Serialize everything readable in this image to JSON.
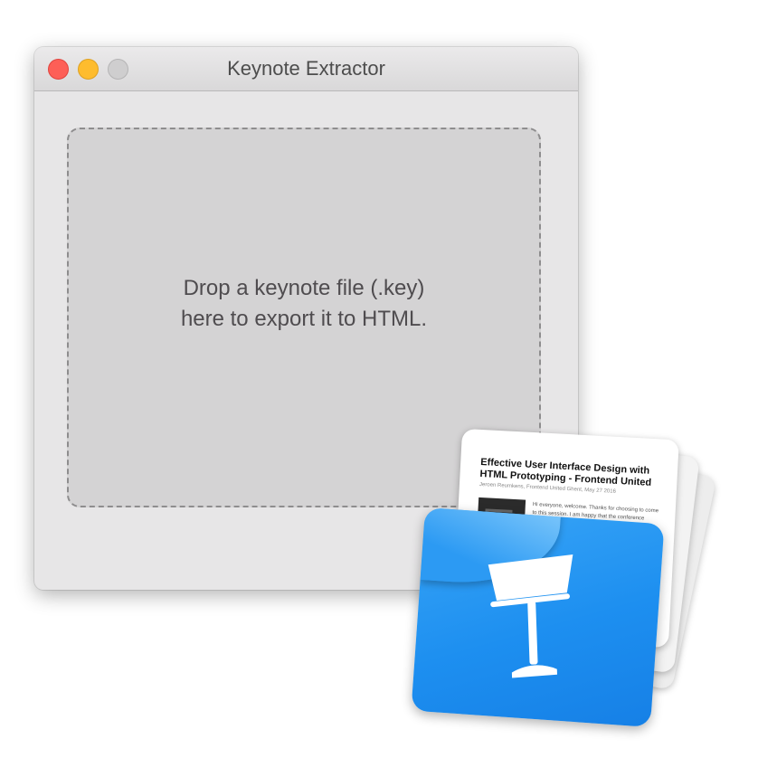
{
  "window": {
    "title": "Keynote Extractor"
  },
  "dropzone": {
    "line1": "Drop a keynote file (.key)",
    "line2": "here to export it to HTML."
  },
  "document_icon": {
    "title": "Effective User Interface Design with HTML Prototyping - Frontend United",
    "subtitle": "Jeroen Reumkens, Frontend United Ghent, May 27 2016",
    "body": "Hi everyone, welcome. Thanks for choosing to come to this session. I am happy that the conference takes place in the Sphinx cinema as it is one of my favorite locations in Ghent.",
    "icon": "keynote-podium-icon"
  },
  "colors": {
    "close": "#fd5f57",
    "minimize": "#febc2e",
    "zoom": "#cfcecf",
    "keynote_blue": "#1d8ff0"
  }
}
